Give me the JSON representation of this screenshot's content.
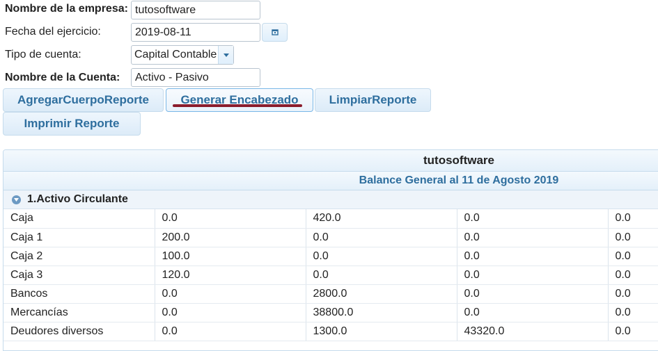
{
  "form": {
    "empresa_label": "Nombre de la empresa:",
    "empresa_value": "tutosoftware",
    "fecha_label": "Fecha del ejercicio:",
    "fecha_value": "2019-08-11",
    "tipo_label": "Tipo de cuenta:",
    "tipo_value": "Capital Contable",
    "cuenta_label": "Nombre de la Cuenta:",
    "cuenta_value": "Activo - Pasivo"
  },
  "buttons": {
    "agregar": "AgregarCuerpoReporte",
    "generar": "Generar Encabezado",
    "limpiar": "LimpiarReporte",
    "imprimir": "Imprimir Reporte"
  },
  "grid": {
    "title": "tutosoftware",
    "subtitle": "Balance General al 11 de Agosto 2019",
    "group_label": "1.Activo Circulante",
    "rows": [
      [
        "Caja",
        "0.0",
        "420.0",
        "0.0",
        "0.0"
      ],
      [
        "Caja 1",
        "200.0",
        "0.0",
        "0.0",
        "0.0"
      ],
      [
        "Caja 2",
        "100.0",
        "0.0",
        "0.0",
        "0.0"
      ],
      [
        "Caja 3",
        "120.0",
        "0.0",
        "0.0",
        "0.0"
      ],
      [
        "Bancos",
        "0.0",
        "2800.0",
        "0.0",
        "0.0"
      ],
      [
        "Mercancías",
        "0.0",
        "38800.0",
        "0.0",
        "0.0"
      ],
      [
        "Deudores diversos",
        "0.0",
        "1300.0",
        "43320.0",
        "0.0"
      ]
    ]
  },
  "icons": {
    "calendar": "calendar-icon",
    "dropdown": "triangle-down-icon",
    "group_toggle": "collapse-icon"
  },
  "colors": {
    "accent": "#2e6e9e",
    "border": "#c5dbec",
    "annotation": "#8b1c2c"
  }
}
